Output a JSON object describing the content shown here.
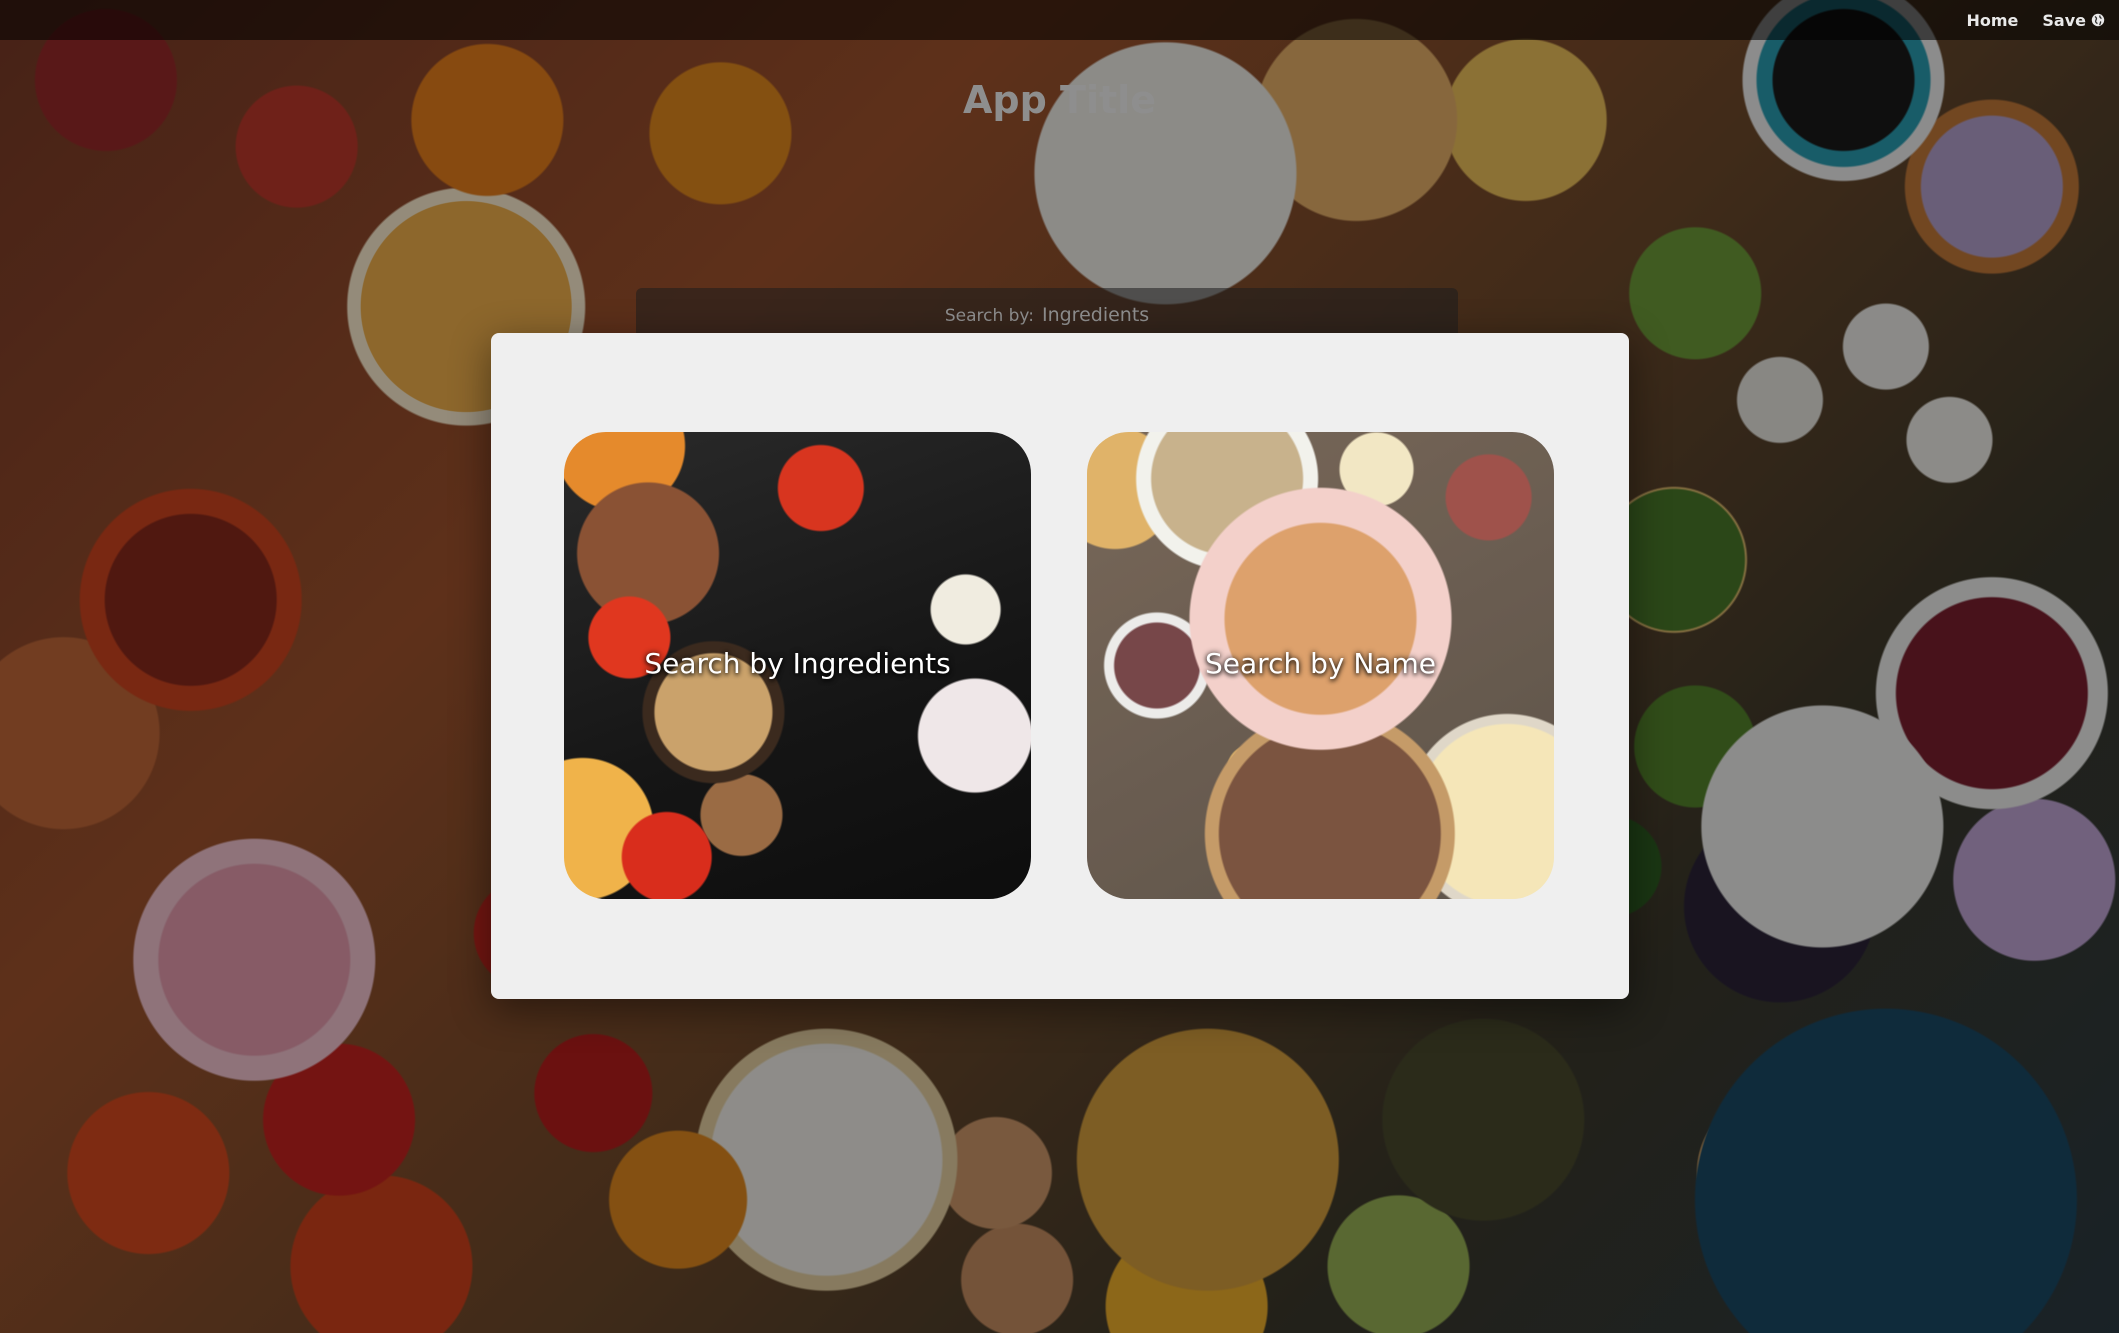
{
  "nav": {
    "home_label": "Home",
    "save_label": "Save"
  },
  "header": {
    "title": "App Title"
  },
  "search": {
    "by_label": "Search by:",
    "by_value": "Ingredients"
  },
  "modal": {
    "options": [
      {
        "label": "Search by Ingredients"
      },
      {
        "label": "Search by Name"
      }
    ]
  },
  "colors": {
    "modal_background": "#efefef",
    "navbar_background": "rgba(0,0,0,0.55)",
    "title_color": "#8e8e8e"
  },
  "icons": {
    "save": "globe-icon"
  }
}
